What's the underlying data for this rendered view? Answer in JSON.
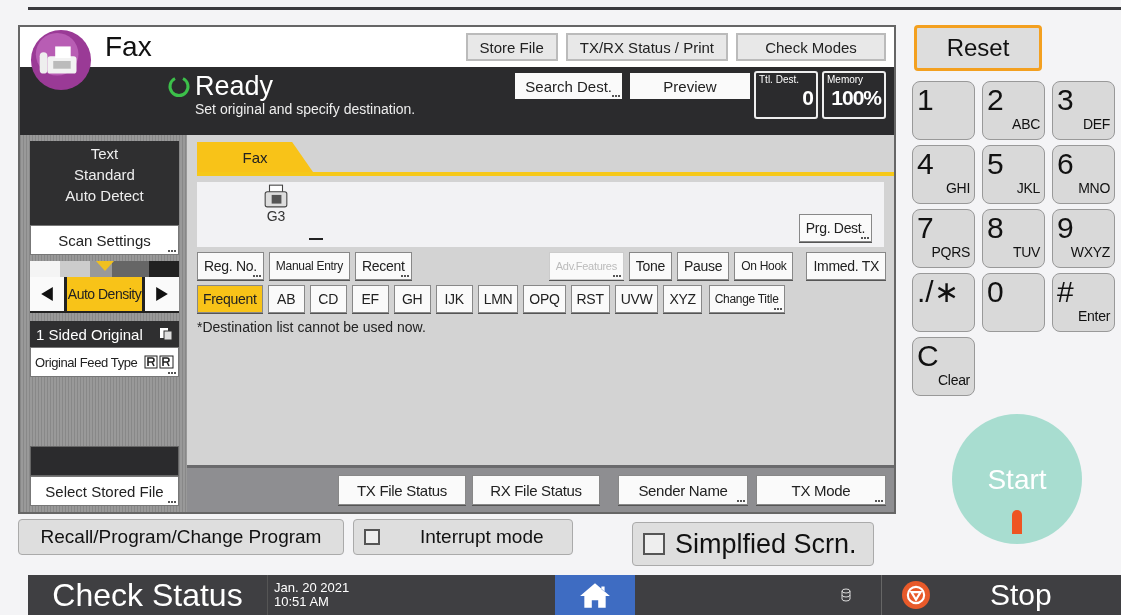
{
  "app": {
    "title": "Fax"
  },
  "header_buttons": [
    {
      "label": "Store File"
    },
    {
      "label": "TX/RX Status / Print"
    },
    {
      "label": "Check Modes"
    }
  ],
  "status": {
    "state": "Ready",
    "message": "Set original and specify destination.",
    "buttons": [
      {
        "label": "Search Dest.",
        "more": true
      },
      {
        "label": "Preview",
        "more": false
      }
    ],
    "counters": [
      {
        "label": "Ttl. Dest.",
        "value": "0"
      },
      {
        "label": "Memory",
        "value": "100%"
      }
    ]
  },
  "scan": {
    "original_lines": [
      "Text",
      "Standard",
      "Auto Detect"
    ],
    "settings": {
      "label": "Scan Settings",
      "more": true
    },
    "density": {
      "level": 0.5,
      "label": "Auto Density",
      "selected": true
    },
    "sides": {
      "label": "1 Sided Original"
    },
    "feed_type": {
      "label": "Original Feed Type",
      "more": true
    },
    "stored_file": {
      "label": "Select Stored File",
      "more": true
    }
  },
  "tabs": [
    {
      "label": "Fax",
      "selected": true
    }
  ],
  "destination": {
    "line": "G3",
    "button": {
      "label": "Prg. Dest.",
      "more": true
    }
  },
  "entry_buttons": [
    {
      "label": "Reg. No.",
      "more": true,
      "disabled": false
    },
    {
      "label": "Manual Entry",
      "more": false,
      "disabled": false
    },
    {
      "label": "Recent",
      "more": true,
      "disabled": false
    },
    {
      "label": "Adv.Features",
      "more": true,
      "disabled": true
    },
    {
      "label": "Tone",
      "more": false,
      "disabled": false
    },
    {
      "label": "Pause",
      "more": false,
      "disabled": false
    },
    {
      "label": "On Hook",
      "more": false,
      "disabled": false
    },
    {
      "label": "Immed. TX",
      "more": false,
      "disabled": false
    }
  ],
  "index_tabs": [
    {
      "label": "Frequent",
      "selected": true,
      "more": false
    },
    {
      "label": "AB",
      "selected": false,
      "more": false
    },
    {
      "label": "CD",
      "selected": false,
      "more": false
    },
    {
      "label": "EF",
      "selected": false,
      "more": false
    },
    {
      "label": "GH",
      "selected": false,
      "more": false
    },
    {
      "label": "IJK",
      "selected": false,
      "more": false
    },
    {
      "label": "LMN",
      "selected": false,
      "more": false
    },
    {
      "label": "OPQ",
      "selected": false,
      "more": false
    },
    {
      "label": "RST",
      "selected": false,
      "more": false
    },
    {
      "label": "UVW",
      "selected": false,
      "more": false
    },
    {
      "label": "XYZ",
      "selected": false,
      "more": false
    },
    {
      "label": "Change Title",
      "selected": false,
      "more": true
    }
  ],
  "note": "*Destination list cannot be used now.",
  "footer_buttons": [
    {
      "label": "TX File Status",
      "more": false
    },
    {
      "label": "RX File Status",
      "more": false
    },
    {
      "label": "Sender Name",
      "more": true
    },
    {
      "label": "TX Mode",
      "more": true
    }
  ],
  "program_button": "Recall/Program/Change Program",
  "toggles": [
    {
      "label": "Interrupt mode",
      "checked": false,
      "kind": "small"
    },
    {
      "label": "Simplfied Scrn.",
      "checked": false,
      "kind": "large"
    }
  ],
  "keypad": {
    "reset": "Reset",
    "keys": [
      {
        "main": "1"
      },
      {
        "main": "2",
        "sub": "ABC"
      },
      {
        "main": "3",
        "sub": "DEF"
      },
      {
        "main": "4",
        "sub": "GHI"
      },
      {
        "main": "5",
        "sub": "JKL"
      },
      {
        "main": "6",
        "sub": "MNO"
      },
      {
        "main": "7",
        "sub": "PQRS"
      },
      {
        "main": "8",
        "sub": "TUV"
      },
      {
        "main": "9",
        "sub": "WXYZ"
      },
      {
        "main": "./∗"
      },
      {
        "main": "0"
      },
      {
        "main": "#",
        "sub": "Enter"
      },
      {
        "main": "C",
        "sub": "Clear"
      }
    ],
    "start": "Start"
  },
  "bottom_bar": {
    "check_status": "Check Status",
    "date": "Jan. 20 2021",
    "time": "10:51 AM",
    "stop": "Stop"
  }
}
